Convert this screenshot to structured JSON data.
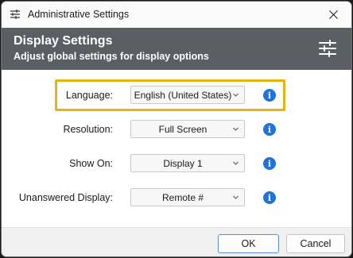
{
  "window": {
    "title": "Administrative Settings"
  },
  "header": {
    "title": "Display Settings",
    "subtitle": "Adjust global settings for display options"
  },
  "settings": [
    {
      "label": "Language:",
      "value": "English (United States)"
    },
    {
      "label": "Resolution:",
      "value": "Full Screen"
    },
    {
      "label": "Show On:",
      "value": "Display 1"
    },
    {
      "label": "Unanswered Display:",
      "value": "Remote #"
    }
  ],
  "info_glyph": "i",
  "footer": {
    "ok_label": "OK",
    "cancel_label": "Cancel"
  },
  "colors": {
    "header_bg": "#5b5e63",
    "info_blue": "#1e74d8",
    "highlight": "#e8b30f",
    "ok_border": "#5a8fd6"
  },
  "icons": {
    "app": "sliders-icon",
    "header": "sliders-icon",
    "close": "close-icon",
    "dropdown": "chevron-down-icon",
    "info": "info-icon"
  }
}
